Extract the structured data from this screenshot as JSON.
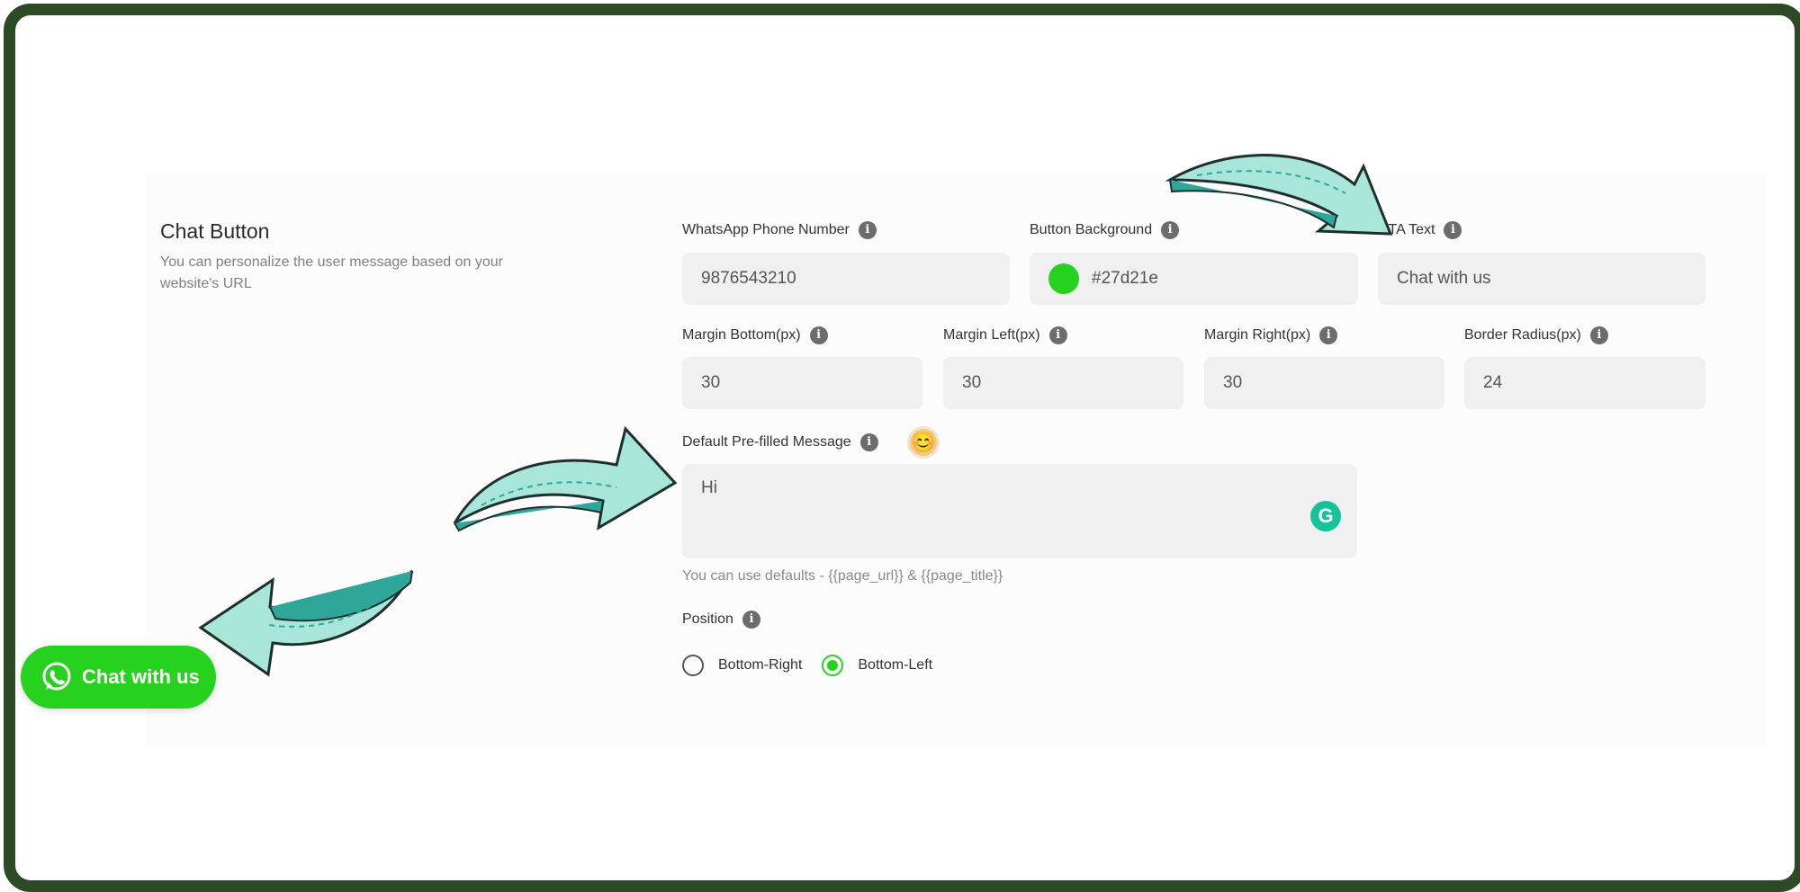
{
  "section": {
    "title": "Chat Button",
    "description": "You can personalize the user message based on your website's URL"
  },
  "fields": {
    "phone": {
      "label": "WhatsApp Phone Number",
      "value": "9876543210"
    },
    "background": {
      "label": "Button Background",
      "value": "#27d21e",
      "swatch_color": "#27d21e"
    },
    "cta": {
      "label": "CTA Text",
      "value": "Chat with us"
    },
    "margin_bottom": {
      "label": "Margin Bottom(px)",
      "value": "30"
    },
    "margin_left": {
      "label": "Margin Left(px)",
      "value": "30"
    },
    "margin_right": {
      "label": "Margin Right(px)",
      "value": "30"
    },
    "border_radius": {
      "label": "Border Radius(px)",
      "value": "24"
    },
    "message": {
      "label": "Default Pre-filled Message",
      "value": "Hi"
    }
  },
  "hint": "You can use defaults - {{page_url}} & {{page_title}}",
  "position": {
    "label": "Position",
    "options": [
      {
        "label": "Bottom-Right",
        "selected": false
      },
      {
        "label": "Bottom-Left",
        "selected": true
      }
    ]
  },
  "chat_button": {
    "label": "Chat with us",
    "color": "#27d21e"
  },
  "icons": {
    "info": "i",
    "emoji": "😊",
    "grammarly": "G"
  },
  "colors": {
    "frame": "#2d4a27",
    "arrow_fill": "#a8e6da",
    "arrow_hatch": "#2fa69a"
  }
}
